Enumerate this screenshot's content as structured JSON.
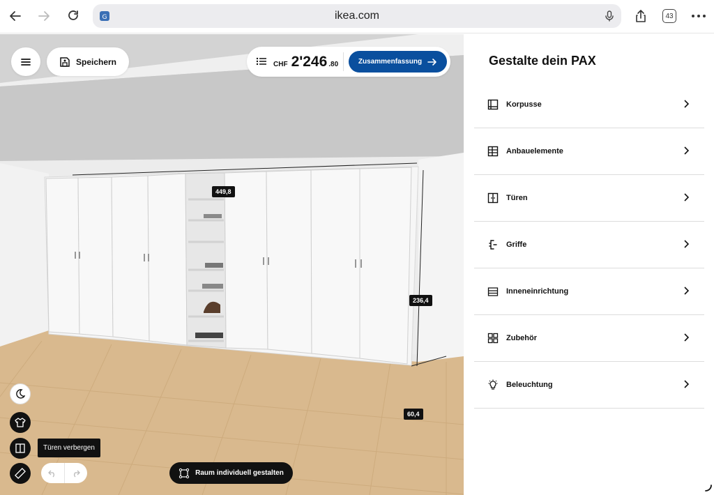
{
  "browser": {
    "url": "ikea.com",
    "tab_count": "43",
    "icons": [
      "back-icon",
      "forward-icon",
      "reload-icon",
      "translate-icon",
      "mic-icon",
      "share-icon",
      "tabs-icon",
      "more-icon"
    ]
  },
  "toolbar": {
    "save_label": "Speichern",
    "price_currency": "CHF",
    "price_main": "2'246",
    "price_cents": ".80",
    "summary_label": "Zusammenfassung"
  },
  "dimensions": {
    "width": "449,8",
    "height": "236,4",
    "depth": "60,4"
  },
  "tools": {
    "tooltip": "Türen verbergen",
    "room_button": "Raum individuell gestalten"
  },
  "panel": {
    "title": "Gestalte dein PAX",
    "items": [
      {
        "label": "Korpusse",
        "icon": "frame-icon"
      },
      {
        "label": "Anbauelemente",
        "icon": "add-on-unit-icon"
      },
      {
        "label": "Türen",
        "icon": "door-icon"
      },
      {
        "label": "Griffe",
        "icon": "handle-icon"
      },
      {
        "label": "Inneneinrichtung",
        "icon": "interior-icon"
      },
      {
        "label": "Zubehör",
        "icon": "accessories-icon"
      },
      {
        "label": "Beleuchtung",
        "icon": "lighting-icon"
      }
    ]
  },
  "colors": {
    "accent": "#0a4f9e",
    "dark": "#111111",
    "floor": "#d9b98e"
  }
}
